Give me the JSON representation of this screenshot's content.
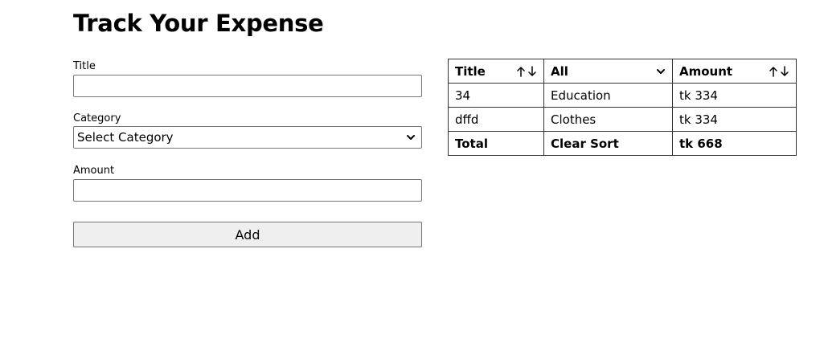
{
  "page": {
    "title": "Track Your Expense"
  },
  "form": {
    "title_label": "Title",
    "title_value": "",
    "category_label": "Category",
    "category_selected": "Select Category",
    "amount_label": "Amount",
    "amount_value": "",
    "add_label": "Add"
  },
  "table": {
    "headers": {
      "title": "Title",
      "category_filter": "All",
      "amount": "Amount"
    },
    "rows": [
      {
        "title": "34",
        "category": "Education",
        "amount": "tk 334"
      },
      {
        "title": "dffd",
        "category": "Clothes",
        "amount": "tk 334"
      }
    ],
    "footer": {
      "total_label": "Total",
      "clear_sort_label": "Clear Sort",
      "total_amount": "tk 668"
    }
  },
  "icons": {
    "sort_asc": "arrow-up-icon",
    "sort_desc": "arrow-down-icon",
    "dropdown": "chevron-down-icon"
  }
}
